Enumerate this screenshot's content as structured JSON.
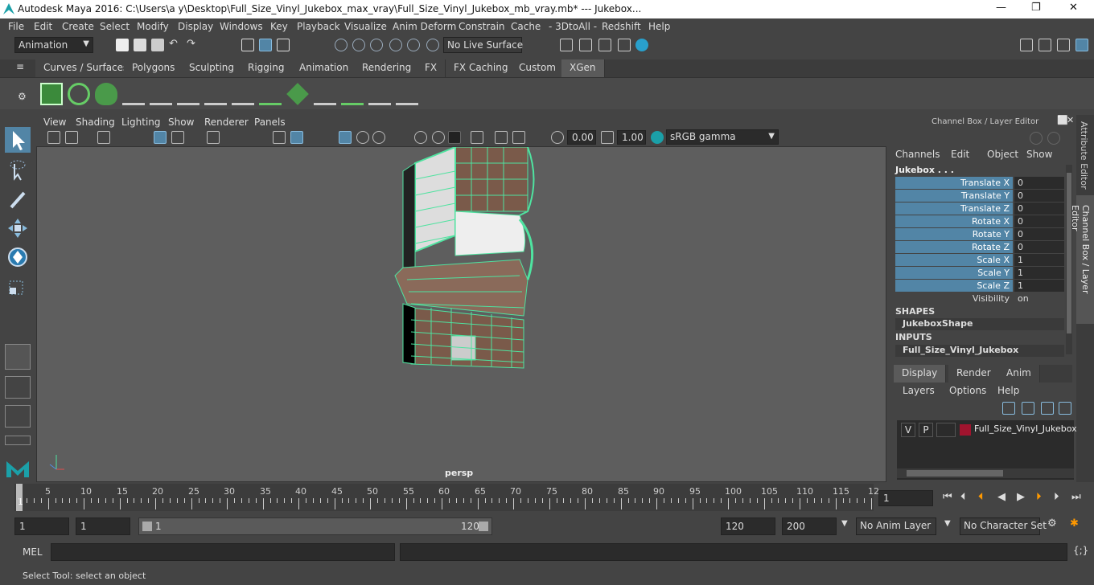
{
  "window": {
    "title": "Autodesk Maya 2016: C:\\Users\\a y\\Desktop\\Full_Size_Vinyl_Jukebox_max_vray\\Full_Size_Vinyl_Jukebox_mb_vray.mb*  ---  Jukebox...",
    "min": "—",
    "max": "❐",
    "close": "✕"
  },
  "menu": [
    "File",
    "Edit",
    "Create",
    "Select",
    "Modify",
    "Display",
    "Windows",
    "Key",
    "Playback",
    "Visualize",
    "Anim Deform",
    "Constrain",
    "Cache",
    "- 3DtoAll -",
    "Redshift",
    "Help"
  ],
  "status": {
    "mode": "Animation",
    "live_surface": "No Live Surface"
  },
  "shelf_tabs": [
    "Curves / Surfaces",
    "Polygons",
    "Sculpting",
    "Rigging",
    "Animation",
    "Rendering",
    "FX",
    "FX Caching",
    "Custom",
    "XGen"
  ],
  "shelf_active": "XGen",
  "viewport": {
    "menu": [
      "View",
      "Shading",
      "Lighting",
      "Show",
      "Renderer",
      "Panels"
    ],
    "exposure": "0.00",
    "gamma": "1.00",
    "color_space": "sRGB gamma",
    "camera": "persp"
  },
  "channelbox": {
    "title": "Channel Box / Layer Editor",
    "menu": [
      "Channels",
      "Edit",
      "Object",
      "Show"
    ],
    "object": "Jukebox . . .",
    "channels": [
      {
        "name": "Translate X",
        "value": "0"
      },
      {
        "name": "Translate Y",
        "value": "0"
      },
      {
        "name": "Translate Z",
        "value": "0"
      },
      {
        "name": "Rotate X",
        "value": "0"
      },
      {
        "name": "Rotate Y",
        "value": "0"
      },
      {
        "name": "Rotate Z",
        "value": "0"
      },
      {
        "name": "Scale X",
        "value": "1"
      },
      {
        "name": "Scale Y",
        "value": "1"
      },
      {
        "name": "Scale Z",
        "value": "1"
      },
      {
        "name": "Visibility",
        "value": "on"
      }
    ],
    "shapes_header": "SHAPES",
    "shape": "JukeboxShape",
    "inputs_header": "INPUTS",
    "input": "Full_Size_Vinyl_Jukebox"
  },
  "layer_editor": {
    "tabs": [
      "Display",
      "Render",
      "Anim"
    ],
    "menu": [
      "Layers",
      "Options",
      "Help"
    ],
    "layer": {
      "v": "V",
      "p": "P",
      "name": "Full_Size_Vinyl_Jukebox",
      "color": "#a0142e"
    }
  },
  "side_tabs": [
    "Attribute Editor",
    "Channel Box / Layer Editor"
  ],
  "timeline": {
    "ticks": [
      "5",
      "10",
      "15",
      "20",
      "25",
      "30",
      "35",
      "40",
      "45",
      "50",
      "55",
      "60",
      "65",
      "70",
      "75",
      "80",
      "85",
      "90",
      "95",
      "100",
      "105",
      "110",
      "115",
      "12"
    ],
    "current_frame": "1",
    "first_label": "1"
  },
  "range": {
    "start": "1",
    "start2": "1",
    "slider_start": "1",
    "slider_end": "120",
    "end": "120",
    "end2": "200",
    "anim_layer": "No Anim Layer",
    "char_set": "No Character Set"
  },
  "cmd": {
    "label": "MEL"
  },
  "help_line": "Select Tool: select an object",
  "colors": {
    "accent": "#5285a6",
    "wire": "#4fe3a0"
  }
}
